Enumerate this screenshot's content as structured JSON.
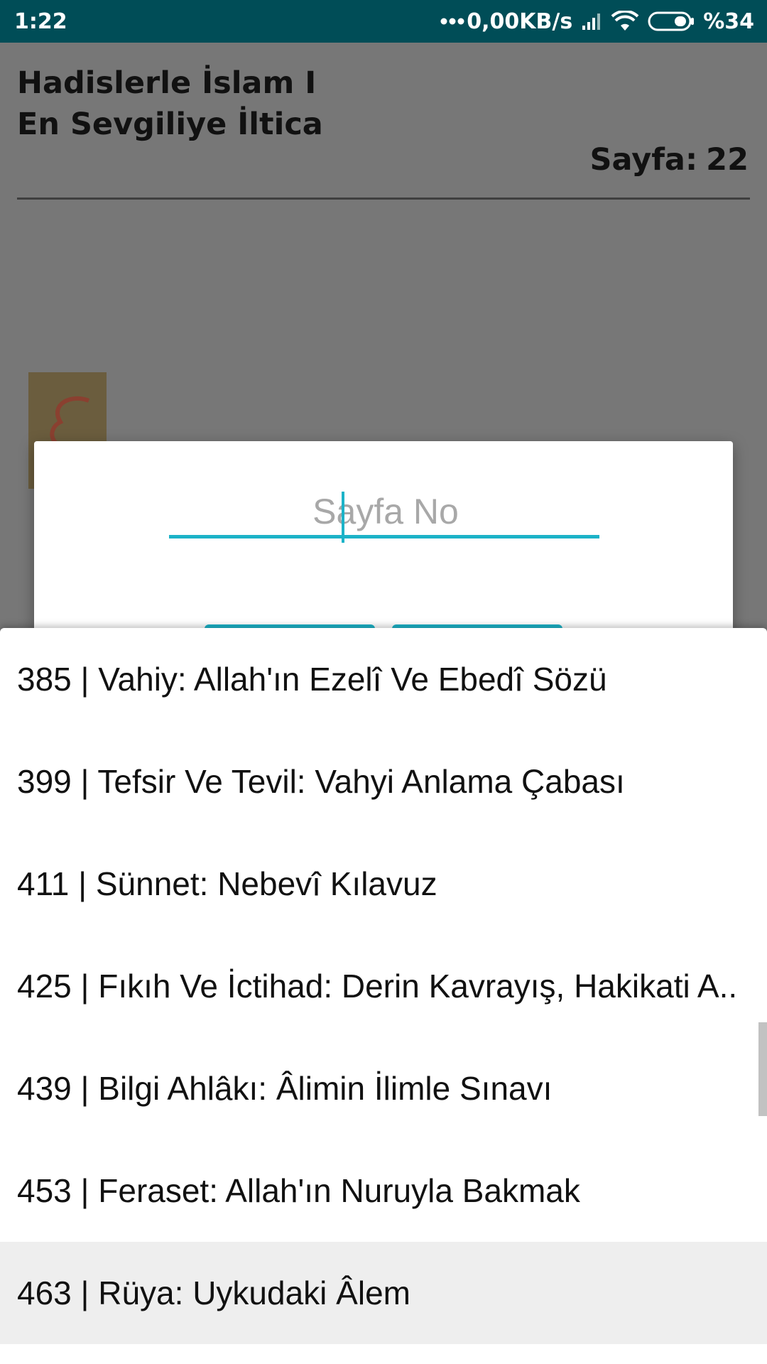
{
  "status_bar": {
    "time": "1:22",
    "network_speed": "0,00KB/s",
    "battery": "%34",
    "icons": [
      "more-dots-icon",
      "signal-icon",
      "wifi-icon",
      "battery-icon"
    ]
  },
  "page": {
    "title_line1": "Hadislerle İslam I",
    "title_line2": "En Sevgiliye İltica",
    "page_label": "Sayfa:",
    "page_number": "22"
  },
  "dialog": {
    "input_placeholder": "Sayfa No",
    "input_value": ""
  },
  "dropdown": {
    "items": [
      "385 | Vahiy: Allah'ın Ezelî Ve Ebedî Sözü",
      "399 | Tefsir Ve Tevil: Vahyi Anlama Çabası",
      "411 | Sünnet: Nebevî Kılavuz",
      "425 | Fıkıh Ve İctihad: Derin Kavrayış, Hakikati A..",
      "439 | Bilgi Ahlâkı: Âlimin İlimle Sınavı",
      "453 | Feraset: Allah'ın Nuruyla Bakmak",
      "463 | Rüya: Uykudaki Âlem"
    ],
    "selected_index": 6
  },
  "colors": {
    "status_bar_bg": "#004d57",
    "accent": "#1cb3c8",
    "dim_background": "#777777",
    "selected_item_bg": "#eeeeee"
  }
}
